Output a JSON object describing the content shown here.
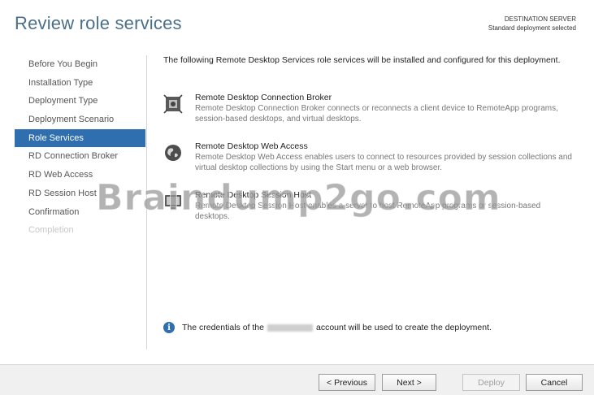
{
  "header": {
    "title": "Review role services",
    "destination_label": "DESTINATION SERVER",
    "destination_value": "Standard deployment selected"
  },
  "nav": {
    "items": [
      {
        "label": "Before You Begin",
        "state": "normal"
      },
      {
        "label": "Installation Type",
        "state": "normal"
      },
      {
        "label": "Deployment Type",
        "state": "normal"
      },
      {
        "label": "Deployment Scenario",
        "state": "normal"
      },
      {
        "label": "Role Services",
        "state": "active"
      },
      {
        "label": "RD Connection Broker",
        "state": "normal"
      },
      {
        "label": "RD Web Access",
        "state": "normal"
      },
      {
        "label": "RD Session Host",
        "state": "normal"
      },
      {
        "label": "Confirmation",
        "state": "normal"
      },
      {
        "label": "Completion",
        "state": "disabled"
      }
    ]
  },
  "main": {
    "intro": "The following Remote Desktop Services role services will be installed and configured for this deployment.",
    "services": [
      {
        "icon": "connection-broker-icon",
        "name": "Remote Desktop Connection Broker",
        "description": "Remote Desktop Connection Broker connects or reconnects a client device to RemoteApp programs, session-based desktops, and virtual desktops."
      },
      {
        "icon": "web-access-globe-icon",
        "name": "Remote Desktop Web Access",
        "description": "Remote Desktop Web Access enables users to connect to resources provided by session collections and virtual desktop collections by using the Start menu or a web browser."
      },
      {
        "icon": "session-host-icon",
        "name": "Remote Desktop Session Host",
        "description": "Remote Desktop Session Host enables a server to host RemoteApp programs or session-based desktops."
      }
    ],
    "info_prefix": "The credentials of the",
    "info_suffix": "account will be used to create the deployment."
  },
  "watermark": "Braindump2go.com",
  "footer": {
    "previous": "< Previous",
    "next": "Next >",
    "deploy": "Deploy",
    "cancel": "Cancel"
  },
  "colors": {
    "accent": "#2f6fb0",
    "title": "#4a6f8a"
  }
}
